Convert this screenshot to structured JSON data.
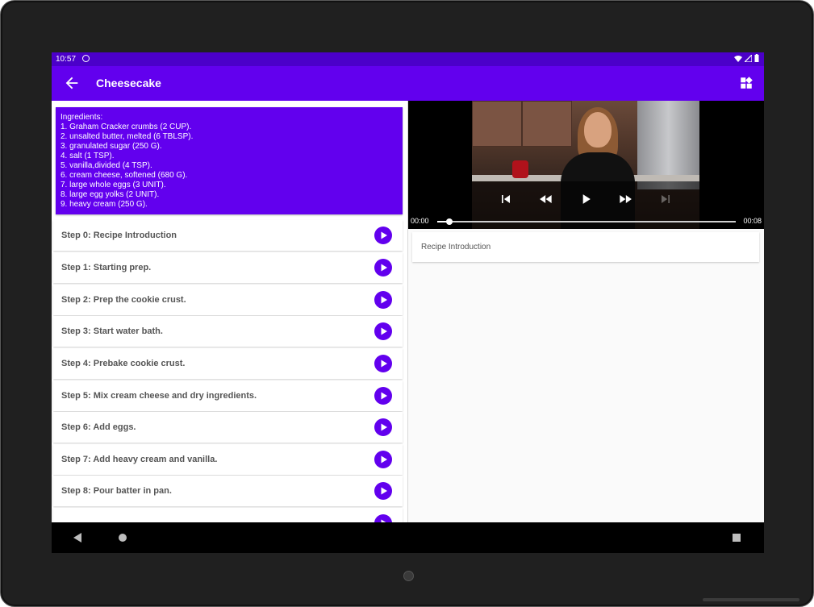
{
  "status_bar": {
    "time": "10:57"
  },
  "app_bar": {
    "title": "Cheesecake"
  },
  "ingredients": [
    "Ingredients:",
    "1. Graham Cracker crumbs (2 CUP).",
    "2. unsalted butter, melted (6 TBLSP).",
    "3. granulated sugar (250 G).",
    "4. salt (1 TSP).",
    "5. vanilla,divided (4 TSP).",
    "6. cream cheese, softened (680 G).",
    "7. large whole eggs (3 UNIT).",
    "8. large egg yolks (2 UNIT).",
    "9. heavy cream (250 G)."
  ],
  "steps": [
    "Step 0: Recipe Introduction",
    "Step 1: Starting prep.",
    "Step 2: Prep the cookie crust.",
    "Step 3: Start water bath.",
    "Step 4: Prebake cookie crust.",
    "Step 5: Mix cream cheese and dry ingredients.",
    "Step 6: Add eggs.",
    "Step 7: Add heavy cream and vanilla.",
    "Step 8: Pour batter in pan."
  ],
  "player": {
    "position": "00:00",
    "duration": "00:08",
    "progress": 0.04
  },
  "step_description": "Recipe Introduction",
  "colors": {
    "primary": "#6200ee",
    "status": "#4b00c9"
  },
  "icons": {
    "back": "arrow-back-icon",
    "widget": "widgets-icon",
    "play": "play-icon",
    "previous": "skip-previous-icon",
    "rewind": "rewind-icon",
    "forward": "fast-forward-icon",
    "next": "skip-next-icon",
    "nav_back": "nav-back-icon",
    "nav_home": "nav-home-icon",
    "nav_recents": "nav-recents-icon"
  }
}
